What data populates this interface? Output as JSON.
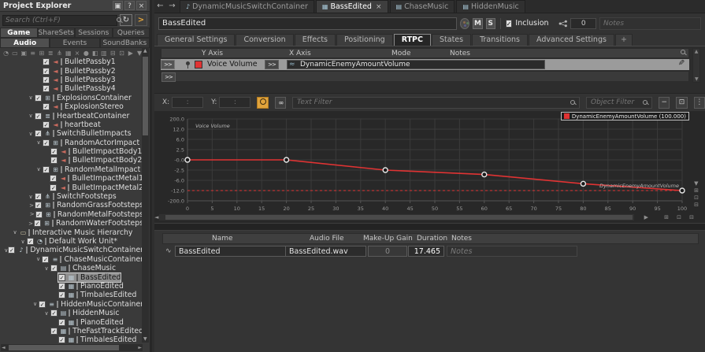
{
  "icon_glyphs": {
    "back": "←",
    "forward": "→",
    "close": "×",
    "help": "?",
    "dock": "▣",
    "refresh": "↻",
    "arrow_right": ">",
    "check": "✓",
    "caret_open": "∨",
    "caret_closed": ">",
    "up": "▲",
    "down": "▼",
    "left": "◄",
    "right": "►",
    "play": "▶",
    "minus": "−",
    "dots": "⋮",
    "pencil": "✎",
    "plus": "+",
    "zoom_in": "⊞",
    "zoom_out": "⊟",
    "zoom_fit": "⊡",
    "sfx": "◄",
    "random": "⊞",
    "sequence": "≣",
    "switch": "⋔",
    "folder": "▭",
    "workunit": "◔",
    "music_switch": "♪",
    "playlist": "≡",
    "segment": "▤",
    "track": "▦",
    "param": "≈",
    "wave": "∿",
    "link": "∞"
  },
  "project_explorer": {
    "title": "Project Explorer",
    "search_placeholder": "Search (Ctrl+F)",
    "tabs_row1": [
      {
        "label": "Game Syncs",
        "active": true
      },
      {
        "label": "ShareSets",
        "active": false
      },
      {
        "label": "Sessions",
        "active": false
      },
      {
        "label": "Queries",
        "active": false
      }
    ],
    "tabs_row2": [
      {
        "label": "Audio",
        "active": true
      },
      {
        "label": "Events",
        "active": false
      },
      {
        "label": "SoundBanks",
        "active": false
      }
    ],
    "toolbar_icons": [
      "profiler-clock",
      "folder",
      "open-folder",
      "filter",
      "random-container",
      "sequence-container",
      "switch-container",
      "blend-container",
      "delete",
      "sound",
      "bus",
      "state",
      "event",
      "grid-view",
      "list-view",
      "columns"
    ],
    "toolbar_glyphs": [
      "◔",
      "▭",
      "▣",
      "≡",
      "⊞",
      "≣",
      "⋔",
      "▦",
      "×",
      "●",
      "◧",
      "▥",
      "⊟",
      "⊡",
      "▶",
      "▼"
    ],
    "tree": [
      {
        "indent": 4,
        "expander": null,
        "checkbox": true,
        "icon": "sfx",
        "label": "BulletPassby1"
      },
      {
        "indent": 4,
        "expander": null,
        "checkbox": true,
        "icon": "sfx",
        "label": "BulletPassby2"
      },
      {
        "indent": 4,
        "expander": null,
        "checkbox": true,
        "icon": "sfx",
        "label": "BulletPassby3"
      },
      {
        "indent": 4,
        "expander": null,
        "checkbox": true,
        "icon": "sfx",
        "label": "BulletPassby4"
      },
      {
        "indent": 3,
        "expander": "open",
        "checkbox": true,
        "icon": "random",
        "label": "ExplosionsContainer"
      },
      {
        "indent": 4,
        "expander": null,
        "checkbox": true,
        "icon": "sfx",
        "label": "ExplosionStereo"
      },
      {
        "indent": 3,
        "expander": "open",
        "checkbox": true,
        "icon": "sequence",
        "label": "HeartbeatContainer"
      },
      {
        "indent": 4,
        "expander": null,
        "checkbox": true,
        "icon": "sfx",
        "label": "heartbeat"
      },
      {
        "indent": 3,
        "expander": "open",
        "checkbox": true,
        "icon": "switch",
        "label": "SwitchBulletImpacts"
      },
      {
        "indent": 4,
        "expander": "open",
        "checkbox": true,
        "icon": "random",
        "label": "RandomActorImpact"
      },
      {
        "indent": 5,
        "expander": null,
        "checkbox": true,
        "icon": "sfx",
        "label": "BulletImpactBody1"
      },
      {
        "indent": 5,
        "expander": null,
        "checkbox": true,
        "icon": "sfx",
        "label": "BulletImpactBody2"
      },
      {
        "indent": 4,
        "expander": "open",
        "checkbox": true,
        "icon": "random",
        "label": "RandomMetalImpact"
      },
      {
        "indent": 5,
        "expander": null,
        "checkbox": true,
        "icon": "sfx",
        "label": "BulletImpactMetal1"
      },
      {
        "indent": 5,
        "expander": null,
        "checkbox": true,
        "icon": "sfx",
        "label": "BulletImpactMetal2"
      },
      {
        "indent": 3,
        "expander": "open",
        "checkbox": true,
        "icon": "switch",
        "label": "SwitchFootsteps"
      },
      {
        "indent": 4,
        "expander": "closed",
        "checkbox": true,
        "icon": "random",
        "label": "RandomGrassFootsteps"
      },
      {
        "indent": 4,
        "expander": "closed",
        "checkbox": true,
        "icon": "random",
        "label": "RandomMetalFootsteps"
      },
      {
        "indent": 4,
        "expander": "closed",
        "checkbox": true,
        "icon": "random",
        "label": "RandomWaterFootsteps"
      },
      {
        "indent": 1,
        "expander": "open",
        "checkbox": false,
        "icon": "folder",
        "label": "Interactive Music Hierarchy"
      },
      {
        "indent": 2,
        "expander": "open",
        "checkbox": true,
        "icon": "workunit",
        "label": "Default Work Unit*"
      },
      {
        "indent": 3,
        "expander": "open",
        "checkbox": true,
        "icon": "music_switch",
        "label": "DynamicMusicSwitchContainer"
      },
      {
        "indent": 4,
        "expander": "open",
        "checkbox": true,
        "icon": "playlist",
        "label": "ChaseMusicContainer"
      },
      {
        "indent": 5,
        "expander": "open",
        "checkbox": true,
        "icon": "segment",
        "label": "ChaseMusic"
      },
      {
        "indent": 6,
        "expander": null,
        "checkbox": true,
        "icon": "track",
        "label": "BassEdited",
        "selected": true
      },
      {
        "indent": 6,
        "expander": null,
        "checkbox": true,
        "icon": "track",
        "label": "PianoEdited"
      },
      {
        "indent": 6,
        "expander": null,
        "checkbox": true,
        "icon": "track",
        "label": "TimbalesEdited"
      },
      {
        "indent": 4,
        "expander": "open",
        "checkbox": true,
        "icon": "playlist",
        "label": "HiddenMusicContainer"
      },
      {
        "indent": 5,
        "expander": "open",
        "checkbox": true,
        "icon": "segment",
        "label": "HiddenMusic"
      },
      {
        "indent": 6,
        "expander": null,
        "checkbox": true,
        "icon": "track",
        "label": "PianoEdited"
      },
      {
        "indent": 6,
        "expander": null,
        "checkbox": true,
        "icon": "track",
        "label": "TheFastTrackEdited"
      },
      {
        "indent": 6,
        "expander": null,
        "checkbox": true,
        "icon": "track",
        "label": "TimbalesEdited"
      }
    ]
  },
  "editor": {
    "doc_tabs": [
      {
        "label": "DynamicMusicSwitchContainer",
        "icon": "music_switch",
        "active": false,
        "closable": false
      },
      {
        "label": "BassEdited",
        "icon": "track",
        "active": true,
        "closable": true
      },
      {
        "label": "ChaseMusic",
        "icon": "segment",
        "active": false,
        "closable": false
      },
      {
        "label": "HiddenMusic",
        "icon": "segment",
        "active": false,
        "closable": false
      }
    ],
    "name_value": "BassEdited",
    "mute_label": "M",
    "solo_label": "S",
    "inclusion_label": "Inclusion",
    "ref_count": "0",
    "notes_placeholder": "Notes",
    "settings_tabs": [
      {
        "label": "General Settings",
        "active": false
      },
      {
        "label": "Conversion",
        "active": false
      },
      {
        "label": "Effects",
        "active": false
      },
      {
        "label": "Positioning",
        "active": false
      },
      {
        "label": "RTPC",
        "active": true
      },
      {
        "label": "States",
        "active": false
      },
      {
        "label": "Transitions",
        "active": false
      },
      {
        "label": "Advanced Settings",
        "active": false
      }
    ],
    "settings_tabs_plus": "+",
    "rtpc": {
      "expand_label": ">>",
      "headers": {
        "y_axis": "Y Axis",
        "x_axis": "X Axis",
        "mode": "Mode",
        "notes": "Notes"
      },
      "row": {
        "swatch_color": "#e03333",
        "y_param": "Voice Volume",
        "x_param": "DynamicEnemyAmountVolume"
      }
    },
    "graph_toolbar": {
      "x_label": "X:",
      "y_label": "Y:",
      "field_separator": ":",
      "text_filter_placeholder": "Text Filter",
      "object_filter_placeholder": "Object Filter"
    }
  },
  "chart_data": {
    "type": "line",
    "title": "",
    "legend": "DynamicEnemyAmountVolume (100.000)",
    "legend_position": "top-right",
    "grid": true,
    "series": [
      {
        "name": "DynamicEnemyAmountVolume",
        "color": "#e03333",
        "points": [
          [
            0,
            0
          ],
          [
            20,
            0
          ],
          [
            40,
            -2.5
          ],
          [
            60,
            -4
          ],
          [
            80,
            -8
          ],
          [
            100,
            -12
          ]
        ]
      }
    ],
    "y_axis": {
      "inplot_label": "Voice Volume",
      "tick_values": [
        200,
        12,
        6,
        2.5,
        0,
        -2.5,
        -6,
        -12,
        -200
      ],
      "tick_labels": [
        "200.0",
        "12.0",
        "6.0",
        "2.5",
        "-0.0",
        "-2.5",
        "-6.0",
        "-12.0",
        "-200.0"
      ],
      "scale": "nonlinear-db"
    },
    "x_axis": {
      "inplot_label": "DynamicEnemyAmountVolume",
      "min": 0,
      "max": 100,
      "tick_step": 5
    },
    "min_marker_line": -12
  },
  "contents_table": {
    "headers": [
      "Name",
      "Audio File",
      "Make-Up Gain",
      "Duration",
      "Notes"
    ],
    "rows": [
      {
        "name": "BassEdited",
        "audio_file": "BassEdited.wav",
        "makeup_gain": "0",
        "duration": "17.465",
        "notes_placeholder": "Notes"
      }
    ]
  }
}
